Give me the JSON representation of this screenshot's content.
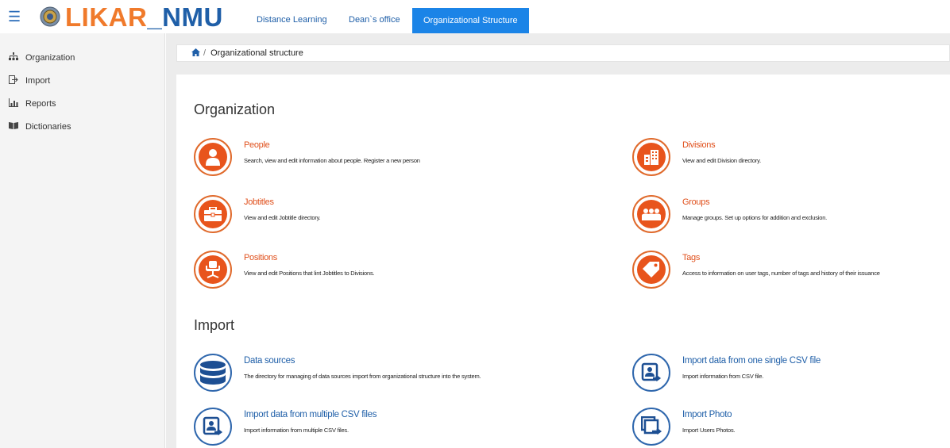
{
  "header": {
    "brand_part1": "LIKAR",
    "brand_part2": "_NMU",
    "nav": [
      {
        "label": "Distance Learning"
      },
      {
        "label": "Dean`s office"
      },
      {
        "label": "Organizational Structure",
        "active": true
      }
    ],
    "accent_color": "#1b84e7",
    "brand_color": "#f07a2b"
  },
  "sidebar": {
    "items": [
      {
        "label": "Organization",
        "icon": "sitemap-icon"
      },
      {
        "label": "Import",
        "icon": "import-icon"
      },
      {
        "label": "Reports",
        "icon": "bar-chart-icon"
      },
      {
        "label": "Dictionaries",
        "icon": "book-icon"
      }
    ]
  },
  "breadcrumb": {
    "separator": "/",
    "current": "Organizational structure"
  },
  "main": {
    "sections": [
      {
        "title": "Organization",
        "tiles": [
          {
            "title": "People",
            "desc": "Search, view and edit information about people. Register a new person",
            "icon": "person-icon"
          },
          {
            "title": "Divisions",
            "desc": "View and edit Division directory.",
            "icon": "building-icon"
          },
          {
            "title": "Jobtitles",
            "desc": "View and edit Jobtitle directory.",
            "icon": "briefcase-icon"
          },
          {
            "title": "Groups",
            "desc": "Manage groups. Set up options for addition and exclusion.",
            "icon": "users-icon"
          },
          {
            "title": "Positions",
            "desc": "View and edit Positions that lint Jobtitles to Divisions.",
            "icon": "office-chair-icon"
          },
          {
            "title": "Tags",
            "desc": "Access to information on user tags, number of tags and history of their issuance",
            "icon": "tag-icon"
          }
        ]
      },
      {
        "title": "Import",
        "tiles": [
          {
            "title": "Data sources",
            "desc": "The directory for managing of data sources import from organizational structure into the system.",
            "icon": "database-icon"
          },
          {
            "title": "Import data from one single CSV file",
            "desc": "Import information from CSV file.",
            "icon": "contact-import-icon"
          },
          {
            "title": "Import data from multiple CSV files",
            "desc": "Import information from multiple CSV files.",
            "icon": "contact-import-icon"
          },
          {
            "title": "Import Photo",
            "desc": "Import Users Photos.",
            "icon": "photo-import-icon"
          }
        ]
      }
    ]
  }
}
